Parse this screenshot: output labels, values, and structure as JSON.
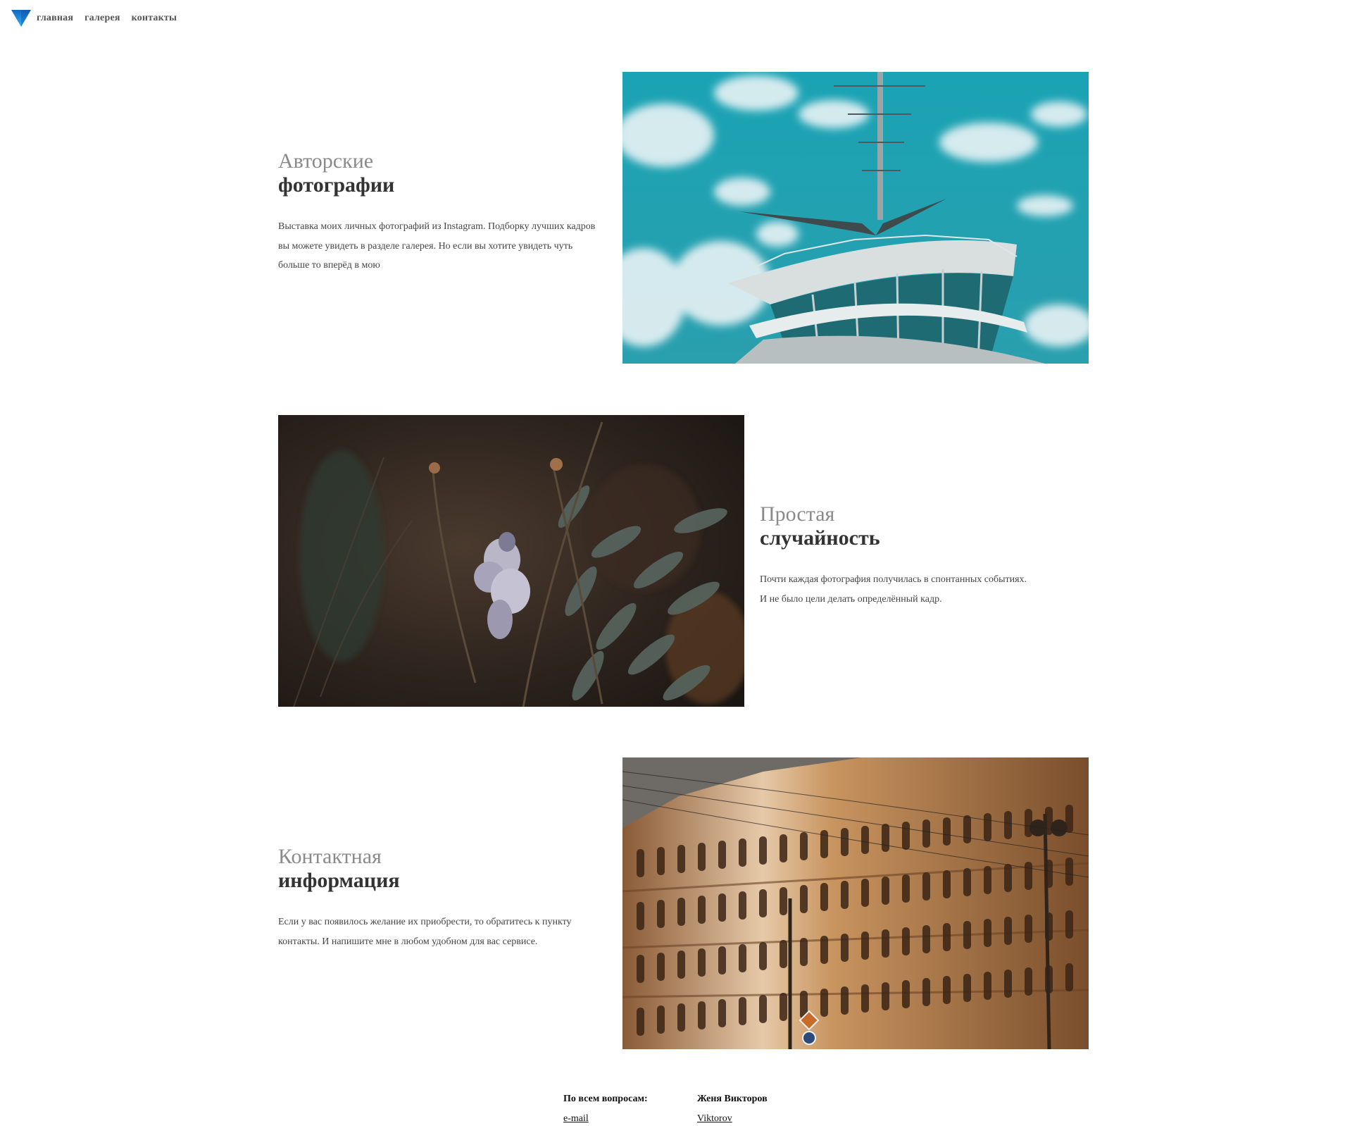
{
  "nav": {
    "logo_icon": "triangle-logo-icon",
    "items": [
      {
        "label": "главная"
      },
      {
        "label": "галерея"
      },
      {
        "label": "контакты"
      }
    ]
  },
  "sections": [
    {
      "title_light": "Авторские",
      "title_bold": "фотографии",
      "description": "Выставка моих личных фотографий из Instagram. Подборку лучших кадров вы можете увидеть в разделе галерея. Но если вы хотите увидеть чуть больше то вперёд в мою",
      "photo": "ship-bridge-sky-photo"
    },
    {
      "title_light": "Простая",
      "title_bold": "случайность",
      "description_lines": [
        "Почти каждая фотография получилась в спонтанных событиях.",
        "И не было цели делать определённый кадр."
      ],
      "photo": "flower-fern-photo"
    },
    {
      "title_light": "Контактная",
      "title_bold": "информация",
      "description": "Если у вас появилось желание их приобрести, то обратитесь к пункту контакты. И напишите мне в любом удобном для вас сервисе.",
      "photo": "city-building-photo"
    }
  ],
  "footer": {
    "col1": {
      "title": "По всем вопросам:",
      "link": "e-mail"
    },
    "col2": {
      "title": "Женя Викторов",
      "link": "Viktorov"
    }
  },
  "colors": {
    "logo_top": "#1e88e5",
    "logo_bottom": "#29b6f6",
    "text": "#3a3a3a",
    "title_light": "#8a8a8a"
  }
}
